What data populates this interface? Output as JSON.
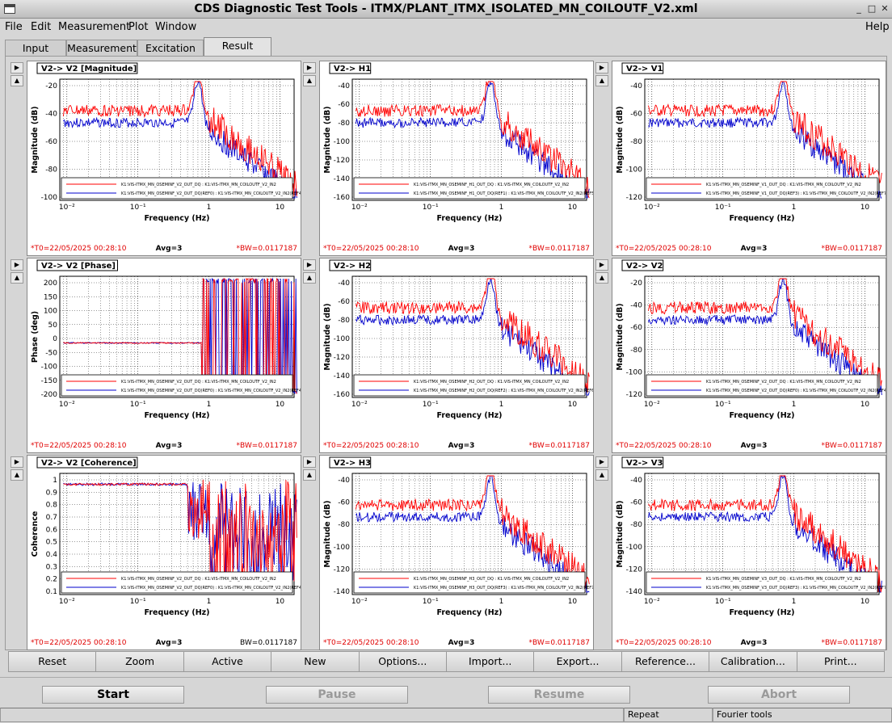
{
  "window": {
    "title": "CDS Diagnostic Test Tools - ITMX/PLANT_ITMX_ISOLATED_MN_COILOUTF_V2.xml"
  },
  "menu": [
    "File",
    "Edit",
    "Measurement",
    "Plot",
    "Window"
  ],
  "help": "Help",
  "tabs": [
    "Input",
    "Measurement",
    "Excitation",
    "Result"
  ],
  "active_tab": "Result",
  "panels": [
    {
      "title": "V2-> V2 [Magnitude]",
      "ylabel": "Magnitude (dB)",
      "ytick": [
        "-20",
        "-40",
        "-60",
        "-80",
        "-100"
      ],
      "legend": [
        "K1:VIS-ITMX_MN_OSEMINF_V2_OUT_DQ : K1:VIS-ITMX_MN_COILOUTF_V2_IN2",
        "K1:VIS-ITMX_MN_OSEMINF_V2_OUT_DQ(REF0) : K1:VIS-ITMX_MN_COILOUTF_V2_IN2(REF4)"
      ],
      "t0": "*T0=22/05/2025 00:28:10",
      "avg": "Avg=3",
      "bw": "*BW=0.0117187",
      "bw_red": true
    },
    {
      "title": "V2-> H1",
      "ylabel": "Magnitude (dB)",
      "ytick": [
        "-40",
        "-60",
        "-80",
        "-100",
        "-120",
        "-140",
        "-160"
      ],
      "legend": [
        "K1:VIS-ITMX_MN_OSEMINF_H1_OUT_DQ : K1:VIS-ITMX_MN_COILOUTF_V2_IN2",
        "K1:VIS-ITMX_MN_OSEMINF_H1_OUT_DQ(REF1) : K1:VIS-ITMX_MN_COILOUTF_V2_IN2(REF5)"
      ],
      "t0": "*T0=22/05/2025 00:28:10",
      "avg": "Avg=3",
      "bw": "*BW=0.0117187",
      "bw_red": true
    },
    {
      "title": "V2-> V1",
      "ylabel": "Magnitude (dB)",
      "ytick": [
        "-40",
        "-60",
        "-80",
        "-100",
        "-120"
      ],
      "legend": [
        "K1:VIS-ITMX_MN_OSEMINF_V1_OUT_DQ : K1:VIS-ITMX_MN_COILOUTF_V2_IN2",
        "K1:VIS-ITMX_MN_OSEMINF_V1_OUT_DQ(REF3) : K1:VIS-ITMX_MN_COILOUTF_V2_IN2(REF7)"
      ],
      "t0": "*T0=22/05/2025 00:28:10",
      "avg": "Avg=3",
      "bw": "*BW=0.0117187",
      "bw_red": true
    },
    {
      "title": "V2-> V2 [Phase]",
      "ylabel": "Phase (deg)",
      "ytick": [
        "200",
        "150",
        "100",
        "50",
        "0",
        "-50",
        "-100",
        "-150",
        "-200"
      ],
      "legend": [
        "K1:VIS-ITMX_MN_OSEMINF_V2_OUT_DQ : K1:VIS-ITMX_MN_COILOUTF_V2_IN2",
        "K1:VIS-ITMX_MN_OSEMINF_V2_OUT_DQ(REF0) : K1:VIS-ITMX_MN_COILOUTF_V2_IN2(REF4)"
      ],
      "t0": "*T0=22/05/2025 00:28:10",
      "avg": "Avg=3",
      "bw": "*BW=0.0117187",
      "bw_red": true
    },
    {
      "title": "V2-> H2",
      "ylabel": "Magnitude (dB)",
      "ytick": [
        "-40",
        "-60",
        "-80",
        "-100",
        "-120",
        "-140",
        "-160"
      ],
      "legend": [
        "K1:VIS-ITMX_MN_OSEMINF_H2_OUT_DQ : K1:VIS-ITMX_MN_COILOUTF_V2_IN2",
        "K1:VIS-ITMX_MN_OSEMINF_H2_OUT_DQ(REF2) : K1:VIS-ITMX_MN_COILOUTF_V2_IN2(REF6)"
      ],
      "t0": "*T0=22/05/2025 00:28:10",
      "avg": "Avg=3",
      "bw": "*BW=0.0117187",
      "bw_red": true
    },
    {
      "title": "V2-> V2",
      "ylabel": "Magnitude (dB)",
      "ytick": [
        "-20",
        "-40",
        "-60",
        "-80",
        "-100",
        "-120"
      ],
      "legend": [
        "K1:VIS-ITMX_MN_OSEMINF_V2_OUT_DQ : K1:VIS-ITMX_MN_COILOUTF_V2_IN2",
        "K1:VIS-ITMX_MN_OSEMINF_V2_OUT_DQ(REF0) : K1:VIS-ITMX_MN_COILOUTF_V2_IN2(REF4)"
      ],
      "t0": "*T0=22/05/2025 00:28:10",
      "avg": "Avg=3",
      "bw": "*BW=0.0117187",
      "bw_red": true
    },
    {
      "title": "V2-> V2 [Coherence]",
      "ylabel": "Coherence",
      "ytick": [
        "1",
        "0.9",
        "0.8",
        "0.7",
        "0.6",
        "0.5",
        "0.4",
        "0.3",
        "0.2",
        "0.1"
      ],
      "legend": [
        "K1:VIS-ITMX_MN_OSEMINF_V2_OUT_DQ : K1:VIS-ITMX_MN_COILOUTF_V2_IN2",
        "K1:VIS-ITMX_MN_OSEMINF_V2_OUT_DQ(REF0) : K1:VIS-ITMX_MN_COILOUTF_V2_IN2(REF4)"
      ],
      "t0": "*T0=22/05/2025 00:28:10",
      "avg": "Avg=3",
      "bw": "BW=0.0117187",
      "bw_red": false
    },
    {
      "title": "V2-> H3",
      "ylabel": "Magnitude (dB)",
      "ytick": [
        "-40",
        "-60",
        "-80",
        "-100",
        "-120",
        "-140"
      ],
      "legend": [
        "K1:VIS-ITMX_MN_OSEMINF_H3_OUT_DQ : K1:VIS-ITMX_MN_COILOUTF_V2_IN2",
        "K1:VIS-ITMX_MN_OSEMINF_H3_OUT_DQ(REF3) : K1:VIS-ITMX_MN_COILOUTF_V2_IN2(REF7)"
      ],
      "t0": "*T0=22/05/2025 00:28:10",
      "avg": "Avg=3",
      "bw": "*BW=0.0117187",
      "bw_red": true
    },
    {
      "title": "V2-> V3",
      "ylabel": "Magnitude (dB)",
      "ytick": [
        "-40",
        "-60",
        "-80",
        "-100",
        "-120",
        "-140"
      ],
      "legend": [
        "K1:VIS-ITMX_MN_OSEMINF_V3_OUT_DQ : K1:VIS-ITMX_MN_COILOUTF_V2_IN2",
        "K1:VIS-ITMX_MN_OSEMINF_V3_OUT_DQ(REF3) : K1:VIS-ITMX_MN_COILOUTF_V2_IN2(REF7)"
      ],
      "t0": "*T0=22/05/2025 00:28:10",
      "avg": "Avg=3",
      "bw": "*BW=0.0117187",
      "bw_red": true
    }
  ],
  "xlabel": "Frequency (Hz)",
  "xtick": [
    "10⁻²",
    "10⁻¹",
    "1",
    "10"
  ],
  "colors": {
    "current": "#ff0000",
    "reference": "#0000cc"
  },
  "bottom_buttons": [
    "Reset",
    "Zoom",
    "Active",
    "New",
    "Options...",
    "Import...",
    "Export...",
    "Reference...",
    "Calibration...",
    "Print..."
  ],
  "controls": [
    {
      "label": "Start",
      "enabled": true
    },
    {
      "label": "Pause",
      "enabled": false
    },
    {
      "label": "Resume",
      "enabled": false
    },
    {
      "label": "Abort",
      "enabled": false
    }
  ],
  "status": [
    "Repeat",
    "Fourier tools"
  ]
}
